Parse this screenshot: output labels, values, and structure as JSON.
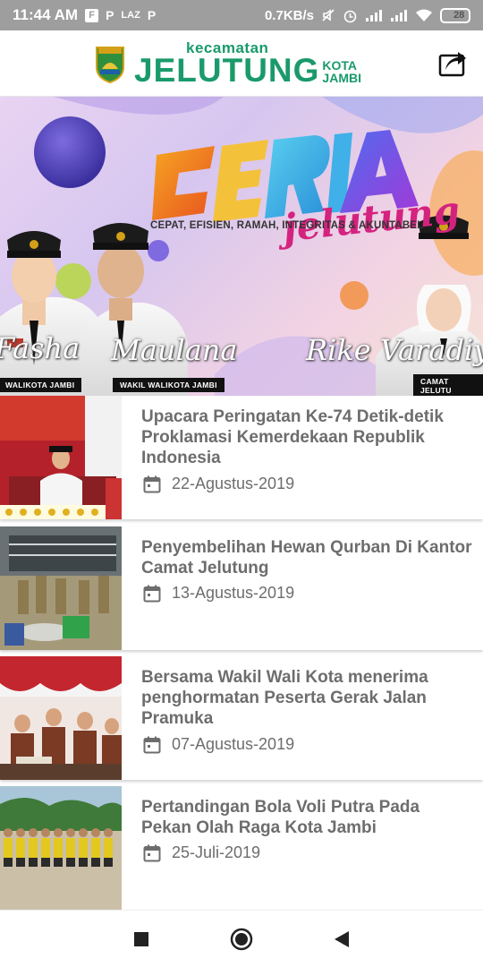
{
  "status_bar": {
    "time": "11:44 AM",
    "notif_icons": [
      "F",
      "P",
      "LAZ",
      "P"
    ],
    "net_speed": "0.7KB/s",
    "battery": "28"
  },
  "header": {
    "brand_small": "kecamatan",
    "brand_big": "JELUTUNG",
    "brand_city_1": "KOTA",
    "brand_city_2": "JAMBI",
    "share_icon": "share-icon"
  },
  "banner": {
    "jelutung_script": "jelutung",
    "ceria": "CERIA",
    "tagline": "CEPAT, EFISIEN, RAMAH, INTEGRITAS & AKUNTABEL",
    "people": [
      {
        "name": "Fasha",
        "role": "WALIKOTA JAMBI"
      },
      {
        "name": "Maulana",
        "role": "WAKIL WALIKOTA JAMBI"
      },
      {
        "name": "Rike Varadiy",
        "role": "CAMAT JELUTU"
      }
    ]
  },
  "news": [
    {
      "title": "Upacara Peringatan Ke-74 Detik-detik Proklamasi Kemerdekaan Republik Indonesia",
      "date": "22-Agustus-2019"
    },
    {
      "title": "Penyembelihan Hewan Qurban Di Kantor Camat Jelutung",
      "date": "13-Agustus-2019"
    },
    {
      "title": "Bersama Wakil Wali Kota menerima penghormatan Peserta Gerak Jalan Pramuka",
      "date": "07-Agustus-2019"
    },
    {
      "title": "Pertandingan Bola Voli Putra Pada Pekan Olah Raga Kota Jambi",
      "date": "25-Juli-2019"
    }
  ],
  "nav": [
    "recent-apps",
    "home",
    "back"
  ]
}
